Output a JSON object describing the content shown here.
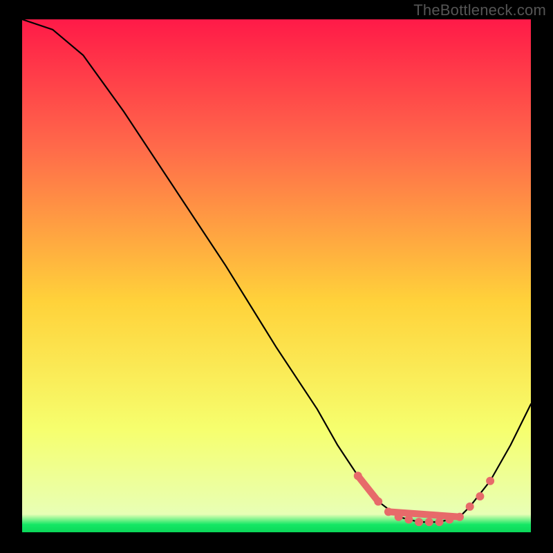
{
  "watermark": "TheBottleneck.com",
  "chart_data": {
    "type": "line",
    "title": "",
    "xlabel": "",
    "ylabel": "",
    "xlim": [
      0,
      100
    ],
    "ylim": [
      0,
      100
    ],
    "grid": false,
    "legend": false,
    "background_gradient": {
      "orientation": "vertical",
      "stops": [
        {
          "pos": 0.0,
          "color": "#ff1a48"
        },
        {
          "pos": 0.25,
          "color": "#ff6a4a"
        },
        {
          "pos": 0.55,
          "color": "#ffd23a"
        },
        {
          "pos": 0.8,
          "color": "#f6ff6e"
        },
        {
          "pos": 0.965,
          "color": "#e8ffb5"
        },
        {
          "pos": 0.985,
          "color": "#14e765"
        },
        {
          "pos": 1.0,
          "color": "#0bd85a"
        }
      ]
    },
    "series": [
      {
        "name": "bottleneck-curve",
        "x": [
          0,
          6,
          12,
          20,
          30,
          40,
          50,
          58,
          62,
          66,
          70,
          74,
          78,
          82,
          86,
          88,
          92,
          96,
          100
        ],
        "y": [
          100,
          98,
          93,
          82,
          67,
          52,
          36,
          24,
          17,
          11,
          6,
          3,
          2,
          2,
          3,
          5,
          10,
          17,
          25
        ]
      }
    ],
    "highlight_cluster": {
      "color": "#e76a6a",
      "segments": [
        {
          "x0": 66,
          "y0": 11,
          "x1": 70,
          "y1": 6
        },
        {
          "x0": 72,
          "y0": 4,
          "x1": 86,
          "y1": 3
        }
      ],
      "dots": [
        {
          "x": 66,
          "y": 11
        },
        {
          "x": 70,
          "y": 6
        },
        {
          "x": 72,
          "y": 4
        },
        {
          "x": 74,
          "y": 3
        },
        {
          "x": 76,
          "y": 2.5
        },
        {
          "x": 78,
          "y": 2
        },
        {
          "x": 80,
          "y": 2
        },
        {
          "x": 82,
          "y": 2
        },
        {
          "x": 84,
          "y": 2.5
        },
        {
          "x": 86,
          "y": 3
        },
        {
          "x": 88,
          "y": 5
        },
        {
          "x": 90,
          "y": 7
        },
        {
          "x": 92,
          "y": 10
        }
      ]
    }
  }
}
